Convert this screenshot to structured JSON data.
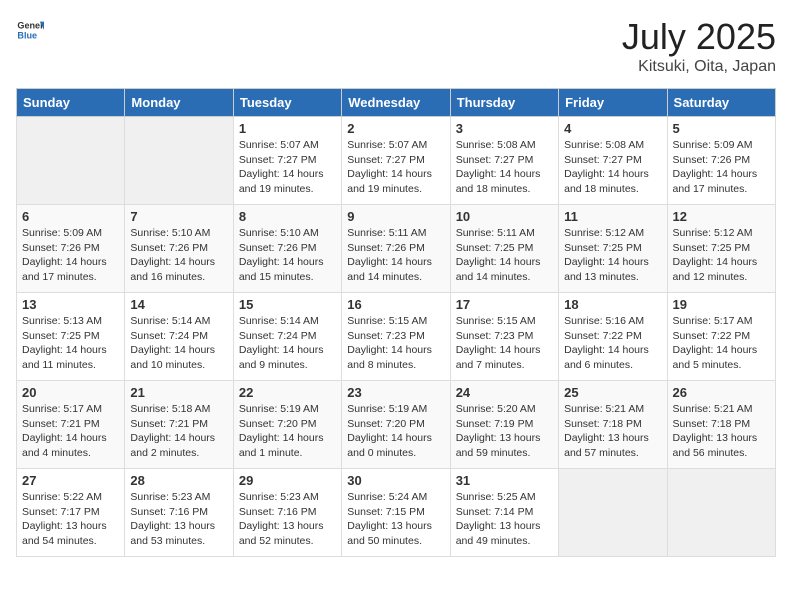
{
  "header": {
    "logo_general": "General",
    "logo_blue": "Blue",
    "title": "July 2025",
    "location": "Kitsuki, Oita, Japan"
  },
  "days_of_week": [
    "Sunday",
    "Monday",
    "Tuesday",
    "Wednesday",
    "Thursday",
    "Friday",
    "Saturday"
  ],
  "weeks": [
    {
      "days": [
        {
          "empty": true
        },
        {
          "empty": true
        },
        {
          "num": "1",
          "sunrise": "Sunrise: 5:07 AM",
          "sunset": "Sunset: 7:27 PM",
          "daylight": "Daylight: 14 hours and 19 minutes."
        },
        {
          "num": "2",
          "sunrise": "Sunrise: 5:07 AM",
          "sunset": "Sunset: 7:27 PM",
          "daylight": "Daylight: 14 hours and 19 minutes."
        },
        {
          "num": "3",
          "sunrise": "Sunrise: 5:08 AM",
          "sunset": "Sunset: 7:27 PM",
          "daylight": "Daylight: 14 hours and 18 minutes."
        },
        {
          "num": "4",
          "sunrise": "Sunrise: 5:08 AM",
          "sunset": "Sunset: 7:27 PM",
          "daylight": "Daylight: 14 hours and 18 minutes."
        },
        {
          "num": "5",
          "sunrise": "Sunrise: 5:09 AM",
          "sunset": "Sunset: 7:26 PM",
          "daylight": "Daylight: 14 hours and 17 minutes."
        }
      ]
    },
    {
      "days": [
        {
          "num": "6",
          "sunrise": "Sunrise: 5:09 AM",
          "sunset": "Sunset: 7:26 PM",
          "daylight": "Daylight: 14 hours and 17 minutes."
        },
        {
          "num": "7",
          "sunrise": "Sunrise: 5:10 AM",
          "sunset": "Sunset: 7:26 PM",
          "daylight": "Daylight: 14 hours and 16 minutes."
        },
        {
          "num": "8",
          "sunrise": "Sunrise: 5:10 AM",
          "sunset": "Sunset: 7:26 PM",
          "daylight": "Daylight: 14 hours and 15 minutes."
        },
        {
          "num": "9",
          "sunrise": "Sunrise: 5:11 AM",
          "sunset": "Sunset: 7:26 PM",
          "daylight": "Daylight: 14 hours and 14 minutes."
        },
        {
          "num": "10",
          "sunrise": "Sunrise: 5:11 AM",
          "sunset": "Sunset: 7:25 PM",
          "daylight": "Daylight: 14 hours and 14 minutes."
        },
        {
          "num": "11",
          "sunrise": "Sunrise: 5:12 AM",
          "sunset": "Sunset: 7:25 PM",
          "daylight": "Daylight: 14 hours and 13 minutes."
        },
        {
          "num": "12",
          "sunrise": "Sunrise: 5:12 AM",
          "sunset": "Sunset: 7:25 PM",
          "daylight": "Daylight: 14 hours and 12 minutes."
        }
      ]
    },
    {
      "days": [
        {
          "num": "13",
          "sunrise": "Sunrise: 5:13 AM",
          "sunset": "Sunset: 7:25 PM",
          "daylight": "Daylight: 14 hours and 11 minutes."
        },
        {
          "num": "14",
          "sunrise": "Sunrise: 5:14 AM",
          "sunset": "Sunset: 7:24 PM",
          "daylight": "Daylight: 14 hours and 10 minutes."
        },
        {
          "num": "15",
          "sunrise": "Sunrise: 5:14 AM",
          "sunset": "Sunset: 7:24 PM",
          "daylight": "Daylight: 14 hours and 9 minutes."
        },
        {
          "num": "16",
          "sunrise": "Sunrise: 5:15 AM",
          "sunset": "Sunset: 7:23 PM",
          "daylight": "Daylight: 14 hours and 8 minutes."
        },
        {
          "num": "17",
          "sunrise": "Sunrise: 5:15 AM",
          "sunset": "Sunset: 7:23 PM",
          "daylight": "Daylight: 14 hours and 7 minutes."
        },
        {
          "num": "18",
          "sunrise": "Sunrise: 5:16 AM",
          "sunset": "Sunset: 7:22 PM",
          "daylight": "Daylight: 14 hours and 6 minutes."
        },
        {
          "num": "19",
          "sunrise": "Sunrise: 5:17 AM",
          "sunset": "Sunset: 7:22 PM",
          "daylight": "Daylight: 14 hours and 5 minutes."
        }
      ]
    },
    {
      "days": [
        {
          "num": "20",
          "sunrise": "Sunrise: 5:17 AM",
          "sunset": "Sunset: 7:21 PM",
          "daylight": "Daylight: 14 hours and 4 minutes."
        },
        {
          "num": "21",
          "sunrise": "Sunrise: 5:18 AM",
          "sunset": "Sunset: 7:21 PM",
          "daylight": "Daylight: 14 hours and 2 minutes."
        },
        {
          "num": "22",
          "sunrise": "Sunrise: 5:19 AM",
          "sunset": "Sunset: 7:20 PM",
          "daylight": "Daylight: 14 hours and 1 minute."
        },
        {
          "num": "23",
          "sunrise": "Sunrise: 5:19 AM",
          "sunset": "Sunset: 7:20 PM",
          "daylight": "Daylight: 14 hours and 0 minutes."
        },
        {
          "num": "24",
          "sunrise": "Sunrise: 5:20 AM",
          "sunset": "Sunset: 7:19 PM",
          "daylight": "Daylight: 13 hours and 59 minutes."
        },
        {
          "num": "25",
          "sunrise": "Sunrise: 5:21 AM",
          "sunset": "Sunset: 7:18 PM",
          "daylight": "Daylight: 13 hours and 57 minutes."
        },
        {
          "num": "26",
          "sunrise": "Sunrise: 5:21 AM",
          "sunset": "Sunset: 7:18 PM",
          "daylight": "Daylight: 13 hours and 56 minutes."
        }
      ]
    },
    {
      "days": [
        {
          "num": "27",
          "sunrise": "Sunrise: 5:22 AM",
          "sunset": "Sunset: 7:17 PM",
          "daylight": "Daylight: 13 hours and 54 minutes."
        },
        {
          "num": "28",
          "sunrise": "Sunrise: 5:23 AM",
          "sunset": "Sunset: 7:16 PM",
          "daylight": "Daylight: 13 hours and 53 minutes."
        },
        {
          "num": "29",
          "sunrise": "Sunrise: 5:23 AM",
          "sunset": "Sunset: 7:16 PM",
          "daylight": "Daylight: 13 hours and 52 minutes."
        },
        {
          "num": "30",
          "sunrise": "Sunrise: 5:24 AM",
          "sunset": "Sunset: 7:15 PM",
          "daylight": "Daylight: 13 hours and 50 minutes."
        },
        {
          "num": "31",
          "sunrise": "Sunrise: 5:25 AM",
          "sunset": "Sunset: 7:14 PM",
          "daylight": "Daylight: 13 hours and 49 minutes."
        },
        {
          "empty": true
        },
        {
          "empty": true
        }
      ]
    }
  ]
}
